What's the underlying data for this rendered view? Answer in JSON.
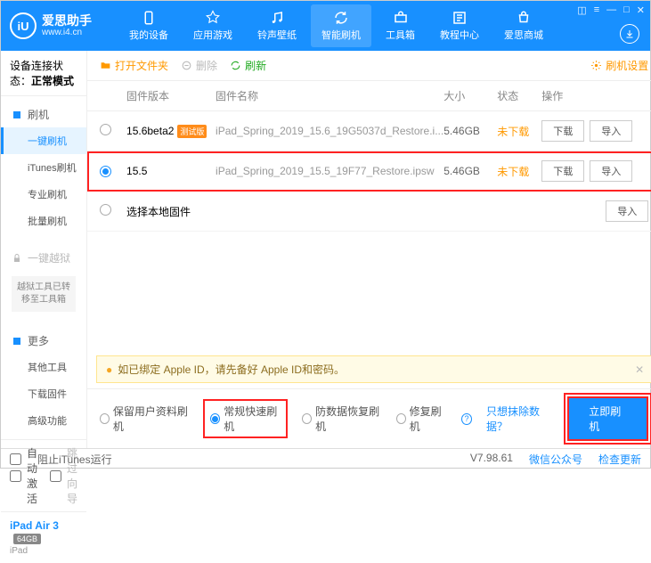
{
  "brand": {
    "name": "爱思助手",
    "url": "www.i4.cn",
    "logo": "iU"
  },
  "nav": {
    "items": [
      "我的设备",
      "应用游戏",
      "铃声壁纸",
      "智能刷机",
      "工具箱",
      "教程中心",
      "爱思商城"
    ],
    "active": 3
  },
  "connStatus": {
    "label": "设备连接状态：",
    "value": "正常模式"
  },
  "side": {
    "g1": {
      "head": "刷机",
      "items": [
        "一键刷机",
        "iTunes刷机",
        "专业刷机",
        "批量刷机"
      ],
      "active": 0
    },
    "g2": {
      "head": "一键越狱",
      "note": "越狱工具已转移至工具箱"
    },
    "g3": {
      "head": "更多",
      "items": [
        "其他工具",
        "下载固件",
        "高级功能"
      ]
    }
  },
  "sbBottom": {
    "autoActivate": "自动激活",
    "skipGuide": "跳过向导"
  },
  "device": {
    "name": "iPad Air 3",
    "storage": "64GB",
    "type": "iPad"
  },
  "toolbar": {
    "openFolder": "打开文件夹",
    "delete": "删除",
    "refresh": "刷新",
    "settings": "刷机设置"
  },
  "table": {
    "headers": [
      "",
      "固件版本",
      "固件名称",
      "大小",
      "状态",
      "操作"
    ],
    "rows": [
      {
        "sel": false,
        "ver": "15.6beta2",
        "tag": "测试版",
        "name": "iPad_Spring_2019_15.6_19G5037d_Restore.i...",
        "size": "5.46GB",
        "status": "未下载"
      },
      {
        "sel": true,
        "ver": "15.5",
        "tag": "",
        "name": "iPad_Spring_2019_15.5_19F77_Restore.ipsw",
        "size": "5.46GB",
        "status": "未下载"
      }
    ],
    "localRow": "选择本地固件",
    "btn": {
      "download": "下载",
      "import": "导入"
    }
  },
  "notice": "如已绑定 Apple ID，请先备好 Apple ID和密码。",
  "modes": {
    "m1": "保留用户资料刷机",
    "m2": "常规快速刷机",
    "m3": "防数据恢复刷机",
    "m4": "修复刷机",
    "link": "只想抹除数据？",
    "action": "立即刷机",
    "active": 1
  },
  "status": {
    "blockItunes": "阻止iTunes运行",
    "version": "V7.98.61",
    "wechat": "微信公众号",
    "update": "检查更新"
  }
}
